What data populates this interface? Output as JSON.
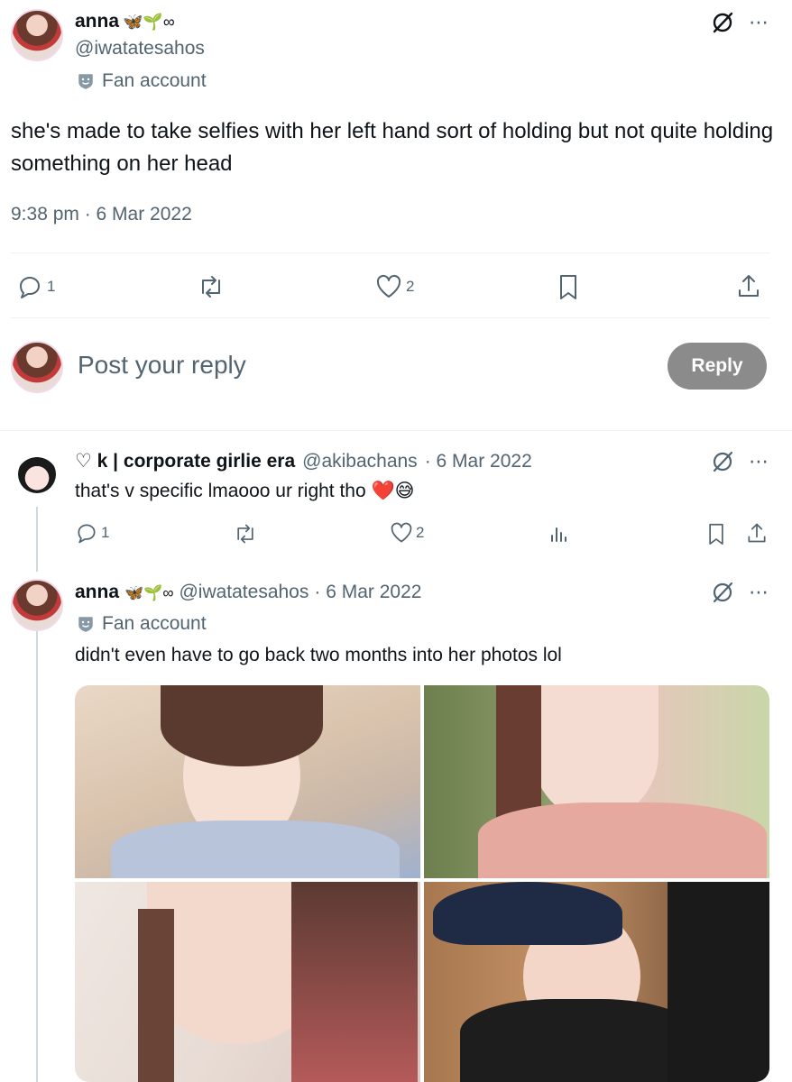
{
  "main_tweet": {
    "display_name": "anna",
    "name_emojis": "🦋🌱∞",
    "handle": "@iwatatesahos",
    "label": "Fan account",
    "text": "she's made to take selfies with her left hand sort of holding but not quite holding something on her head",
    "timestamp": "9:38 pm · 6 Mar 2022",
    "actions": {
      "replies": "1",
      "likes": "2"
    }
  },
  "compose": {
    "placeholder": "Post your reply",
    "reply_label": "Reply"
  },
  "reply_1": {
    "display_name": "♡ k | corporate girlie era",
    "handle": "@akibachans",
    "date": "· 6 Mar 2022",
    "text": "that's v specific lmaooo ur right tho ❤️😅",
    "actions": {
      "replies": "1",
      "likes": "2"
    }
  },
  "reply_2": {
    "display_name": "anna",
    "name_emojis": "🦋🌱∞",
    "handle": "@iwatatesahos",
    "date": "· 6 Mar 2022",
    "label": "Fan account",
    "text": "didn't even have to go back two months into her photos lol"
  },
  "colors": {
    "muted": "#536471",
    "divider": "#eff3f4",
    "reply_button": "#8b8b8b"
  },
  "icons": [
    "reply-icon",
    "retweet-icon",
    "like-icon",
    "bookmark-icon",
    "share-icon",
    "views-icon",
    "grok-icon",
    "more-icon",
    "fan-account-icon"
  ]
}
